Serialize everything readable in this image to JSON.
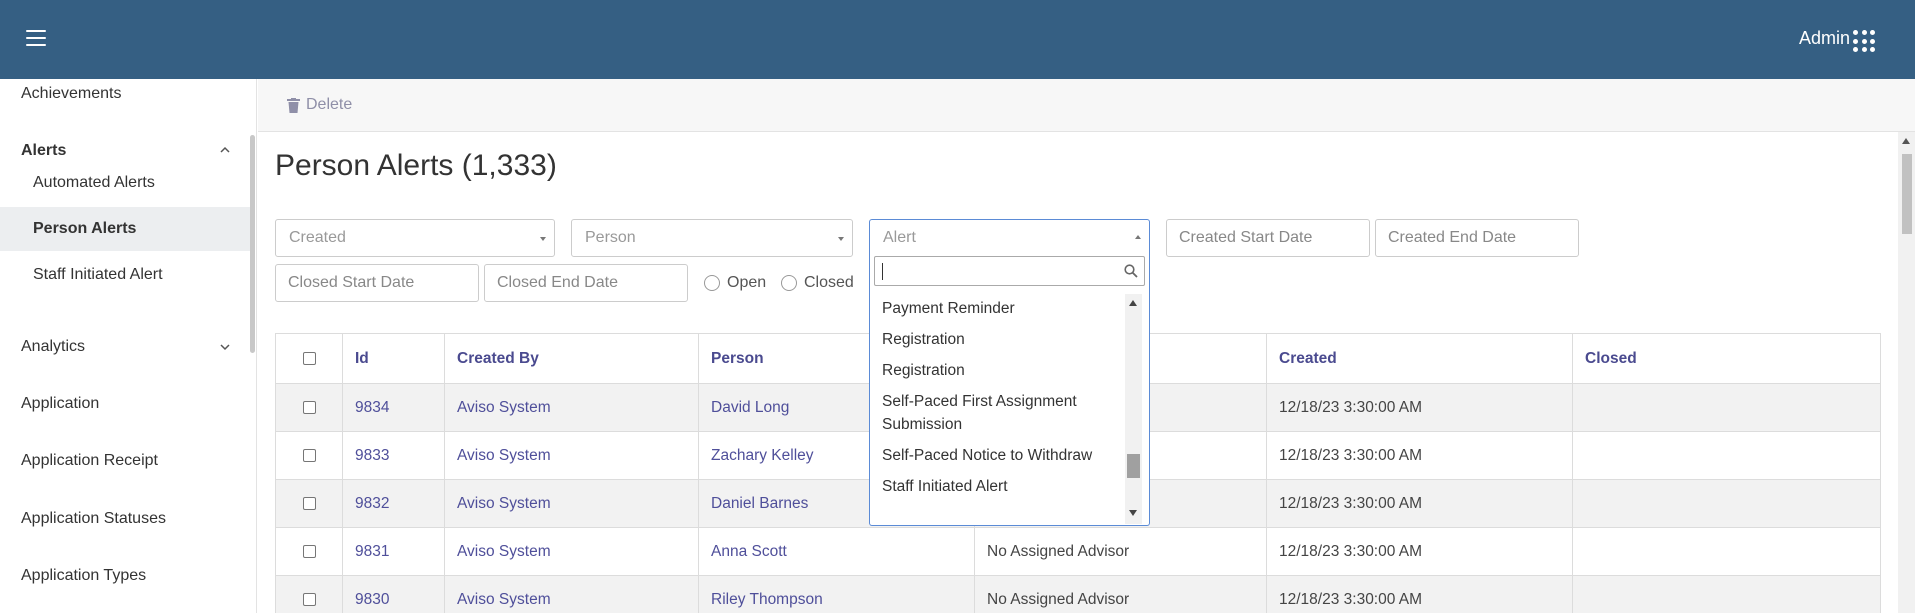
{
  "header": {
    "user": "Admin"
  },
  "sidebar": {
    "items": [
      {
        "label": "Achievements"
      },
      {
        "label": "Alerts",
        "expanded": true
      },
      {
        "label": "Analytics"
      },
      {
        "label": "Application"
      },
      {
        "label": "Application Receipt"
      },
      {
        "label": "Application Statuses"
      },
      {
        "label": "Application Types"
      }
    ],
    "alerts_sub": [
      {
        "label": "Automated Alerts"
      },
      {
        "label": "Person Alerts",
        "active": true
      },
      {
        "label": "Staff Initiated Alert"
      }
    ]
  },
  "toolbar": {
    "delete_label": "Delete"
  },
  "page": {
    "title": "Person Alerts (1,333)"
  },
  "filters": {
    "created_placeholder": "Created",
    "person_placeholder": "Person",
    "alert_placeholder": "Alert",
    "created_start": "Created Start Date",
    "created_end": "Created End Date",
    "closed_start": "Closed Start Date",
    "closed_end": "Closed End Date",
    "radio_open": "Open",
    "radio_closed": "Closed"
  },
  "alert_dropdown": {
    "search_value": "",
    "options": [
      "Payment Reminder",
      "Registration",
      "Registration",
      "Self-Paced First Assignment Submission",
      "Self-Paced Notice to Withdraw",
      "Staff Initiated Alert"
    ]
  },
  "table": {
    "headers": [
      "Id",
      "Created By",
      "Person",
      "",
      "Created",
      "Closed"
    ],
    "rows": [
      {
        "id": "9834",
        "created_by": "Aviso System",
        "person": "David Long",
        "alert": "",
        "created": "12/18/23 3:30:00 AM",
        "closed": ""
      },
      {
        "id": "9833",
        "created_by": "Aviso System",
        "person": "Zachary Kelley",
        "alert": "",
        "created": "12/18/23 3:30:00 AM",
        "closed": ""
      },
      {
        "id": "9832",
        "created_by": "Aviso System",
        "person": "Daniel Barnes",
        "alert": "",
        "created": "12/18/23 3:30:00 AM",
        "closed": ""
      },
      {
        "id": "9831",
        "created_by": "Aviso System",
        "person": "Anna Scott",
        "alert": "No Assigned Advisor",
        "created": "12/18/23 3:30:00 AM",
        "closed": ""
      },
      {
        "id": "9830",
        "created_by": "Aviso System",
        "person": "Riley Thompson",
        "alert": "No Assigned Advisor",
        "created": "12/18/23 3:30:00 AM",
        "closed": ""
      }
    ]
  },
  "colors": {
    "header_bg": "#355f83",
    "link": "#4f4f9a"
  }
}
